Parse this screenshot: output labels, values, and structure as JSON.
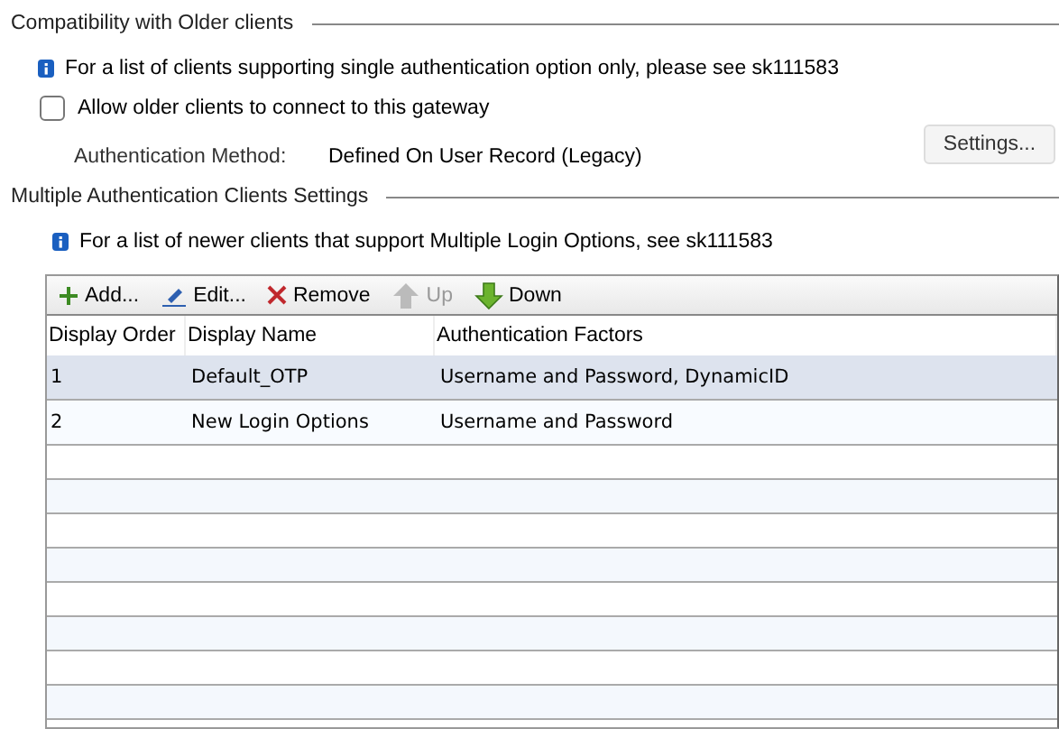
{
  "legacy_section": {
    "title": "Compatibility with Older clients",
    "info": "For a list of clients supporting single authentication option only, please see sk111583",
    "allow_checkbox": {
      "label": "Allow older clients to connect to this gateway",
      "checked": false
    },
    "method_label": "Authentication Method:",
    "method_value": "Defined On User Record (Legacy)",
    "settings_button": "Settings..."
  },
  "multi_section": {
    "title": "Multiple Authentication Clients Settings",
    "info": "For a list of newer clients that support Multiple Login Options, see sk111583",
    "toolbar": [
      {
        "kind": "add",
        "label": "Add...",
        "disabled": false
      },
      {
        "kind": "edit",
        "label": "Edit...",
        "disabled": false
      },
      {
        "kind": "remove",
        "label": "Remove",
        "disabled": false
      },
      {
        "kind": "up",
        "label": "Up",
        "disabled": true
      },
      {
        "kind": "down",
        "label": "Down",
        "disabled": false
      }
    ],
    "table": {
      "columns": [
        "Display Order",
        "Display Name",
        "Authentication Factors"
      ],
      "rows": [
        {
          "cells": [
            "1",
            "Default_OTP",
            "Username and Password, DynamicID"
          ],
          "selected": true
        },
        {
          "cells": [
            "2",
            "New Login Options",
            "Username and Password"
          ],
          "selected": false
        }
      ]
    }
  }
}
